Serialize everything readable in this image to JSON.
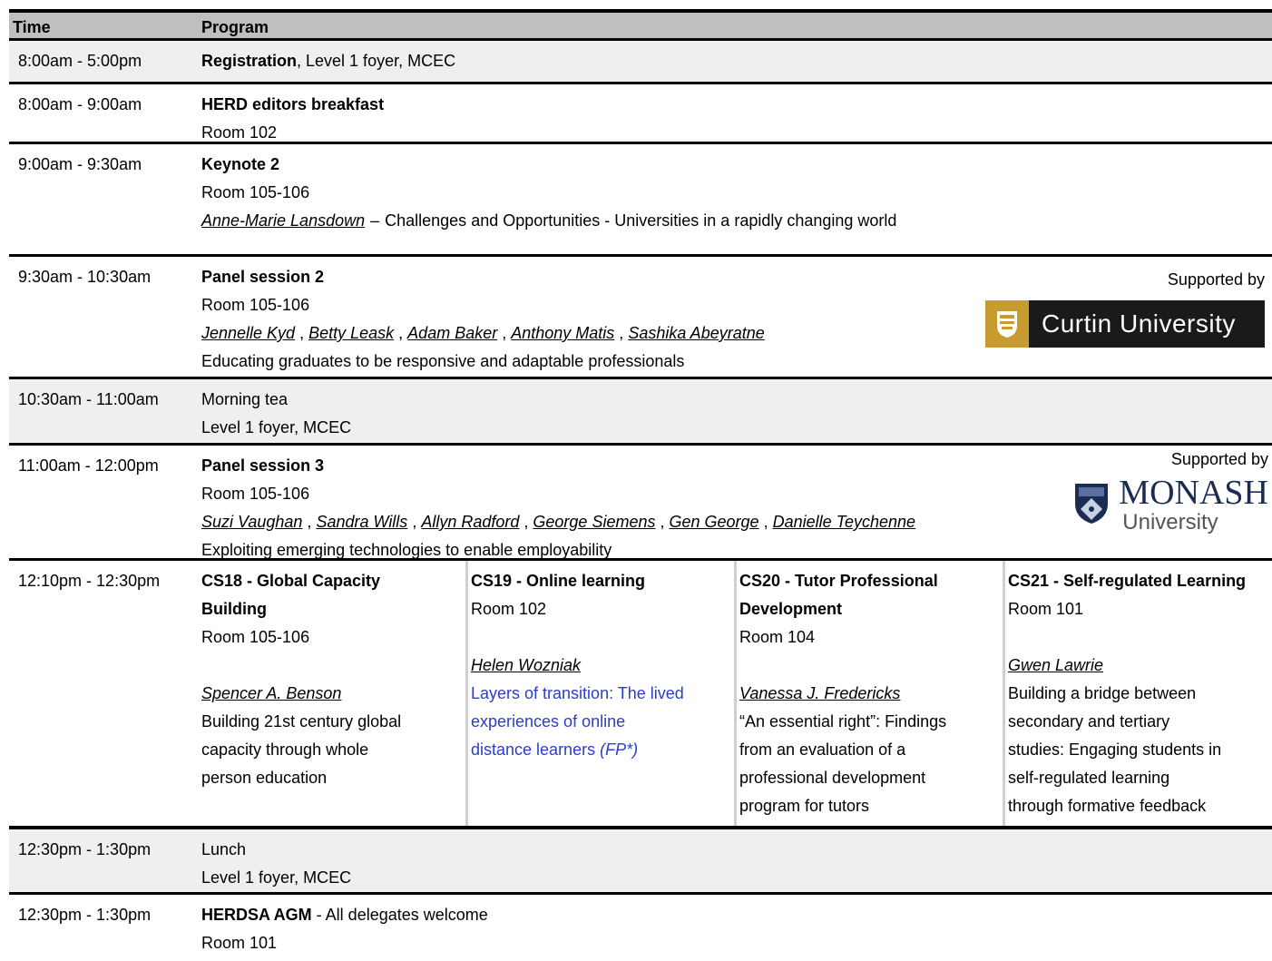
{
  "header": {
    "time": "Time",
    "program": "Program"
  },
  "registration": {
    "time": "8:00am - 5:00pm",
    "title": "Registration",
    "rest": ", Level 1 foyer, MCEC"
  },
  "herd": {
    "time": "8:00am - 9:00am",
    "title": "HERD editors breakfast",
    "room": "Room 102"
  },
  "keynote": {
    "time": "9:00am - 9:30am",
    "title": "Keynote 2",
    "room": "Room 105-106",
    "speaker": "Anne-Marie Lansdown",
    "dash": "–",
    "talk": "Challenges and Opportunities - Universities in a rapidly changing world"
  },
  "panel2": {
    "time": "9:30am - 10:30am",
    "title": "Panel session 2",
    "room": "Room 105-106",
    "speakers": [
      "Jennelle Kyd",
      "Betty Leask",
      "Adam Baker",
      "Anthony Matis",
      "Sashika Abeyratne"
    ],
    "topic": "Educating graduates to be responsive and adaptable professionals",
    "supported_by": "Supported by",
    "sponsor": "Curtin University"
  },
  "morning_tea": {
    "time": "10:30am - 11:00am",
    "title": "Morning tea",
    "place": "Level 1 foyer, MCEC"
  },
  "panel3": {
    "time": "11:00am - 12:00pm",
    "title": "Panel session 3",
    "room": "Room 105-106",
    "speakers": [
      "Suzi Vaughan",
      "Sandra Wills",
      "Allyn Radford",
      "George Siemens",
      "Gen George",
      "Danielle Teychenne"
    ],
    "topic": "Exploiting emerging technologies to enable employability",
    "supported_by": "Supported by",
    "sponsor_name": "MONASH",
    "sponsor_sub": "University"
  },
  "concurrent": {
    "time": "12:10pm - 12:30pm",
    "cs18": {
      "title1": "CS18 - Global Capacity",
      "title2": "Building",
      "room": "Room 105-106",
      "speaker": "Spencer A. Benson",
      "paper": [
        "Building 21st century global",
        "capacity through whole",
        "person education"
      ]
    },
    "cs19": {
      "title": "CS19 - Online learning",
      "room": "Room 102",
      "speaker": "Helen Wozniak",
      "paper": [
        "Layers of transition: The lived",
        "experiences of online",
        "distance learners"
      ],
      "note": "(FP*)"
    },
    "cs20": {
      "title1": "CS20 - Tutor Professional",
      "title2": "Development",
      "room": "Room 104",
      "speaker": "Vanessa J. Fredericks",
      "paper": [
        "“An essential right”: Findings",
        "from an evaluation of a",
        "professional development",
        "program for tutors"
      ]
    },
    "cs21": {
      "title": "CS21 - Self-regulated Learning",
      "room": "Room 101",
      "speaker": "Gwen Lawrie",
      "paper": [
        "Building a bridge between",
        "secondary and tertiary",
        "studies: Engaging students in",
        "self-regulated learning",
        "through formative feedback"
      ]
    }
  },
  "lunch": {
    "time": "12:30pm - 1:30pm",
    "title": "Lunch",
    "place": "Level 1 foyer, MCEC"
  },
  "agm": {
    "time": "12:30pm - 1:30pm",
    "title": "HERDSA AGM",
    "rest": " - All delegates welcome",
    "room": "Room 101"
  }
}
